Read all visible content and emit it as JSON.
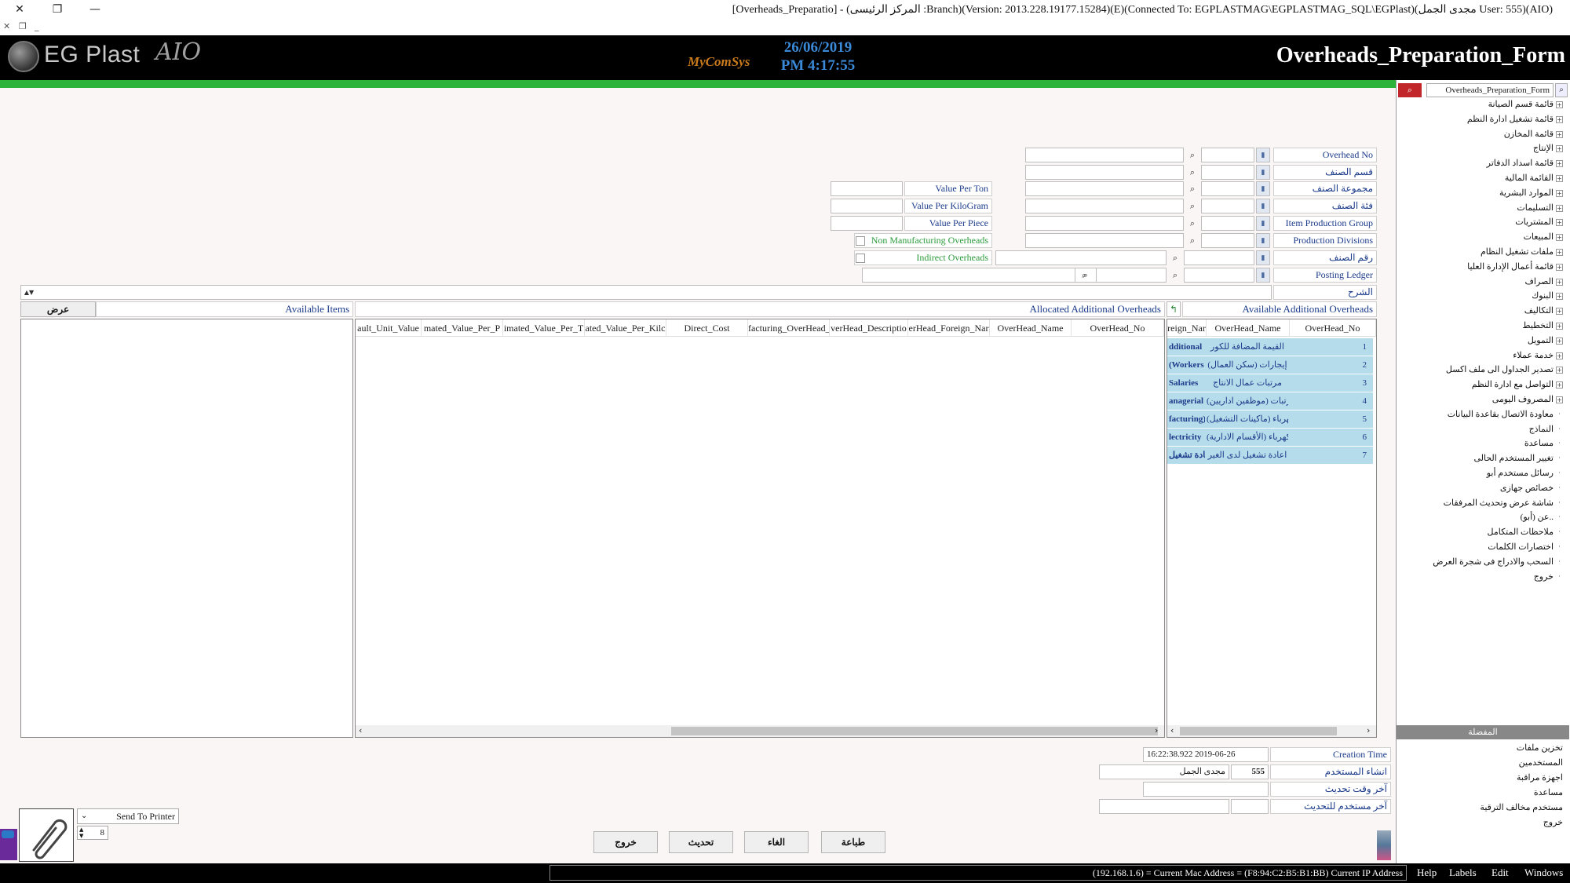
{
  "window": {
    "title": "[Overheads_Preparatio] - (المركز الرئيسى :Branch)(Version: 2013.228.19177.15284)(E)(Connected To: EGPLASTMAG\\EGPLASTMAG_SQL\\EGPlast)(مجدى الجمل User: 555)(AIO)"
  },
  "header": {
    "logo_text": "EG Plast",
    "logo_suffix": "AIO",
    "mycomsys": "MyComSys",
    "date": "26/06/2019",
    "time": "PM 4:17:55",
    "form_title": "Overheads_Preparation_Form"
  },
  "form": {
    "fields_right": [
      {
        "label": "Overhead No"
      },
      {
        "label": "قسم الصنف"
      },
      {
        "label": "مجموعة الصنف"
      },
      {
        "label": "فئة الصنف"
      },
      {
        "label": "Item Production Group"
      },
      {
        "label": "Production Divisions"
      },
      {
        "label": "رقم الصنف"
      },
      {
        "label": "Posting Ledger"
      }
    ],
    "explanation_label": "الشرح",
    "value_labels": [
      "Value Per Ton",
      "Value Per KiloGram",
      "Value Per Piece"
    ],
    "non_manufacturing_label": "Non Manufacturing Overheads",
    "indirect_label": "Indirect Overheads"
  },
  "available_items": {
    "title": "Available Items",
    "show_button": "عرض"
  },
  "allocated": {
    "title": "Allocated Additional Overheads",
    "columns": [
      "ault_Unit_Value",
      "mated_Value_Per_P",
      "imated_Value_Per_T",
      "ated_Value_Per_Kilc",
      "Direct_Cost",
      "facturing_OverHead_",
      "verHead_Descriptio",
      "erHead_Foreign_Nar",
      "OverHead_Name",
      "OverHead_No"
    ]
  },
  "available_overheads": {
    "title": "Available Additional Overheads",
    "columns": [
      "reign_Nar",
      "OverHead_Name",
      "OverHead_No"
    ],
    "rows": [
      {
        "no": "1",
        "name": "القيمة المضافة للكور",
        "foreign": "dditional"
      },
      {
        "no": "2",
        "name": "إيجارات (سكن العمال)",
        "foreign": "(Workers"
      },
      {
        "no": "3",
        "name": "مرتبات عمال الانتاج",
        "foreign": "Salaries"
      },
      {
        "no": "4",
        "name": "مرتبات (موظفين اداريين)",
        "foreign": "anagerial"
      },
      {
        "no": "5",
        "name": "كهرباء (ماكينات التشغيل)",
        "foreign": "facturing)"
      },
      {
        "no": "6",
        "name": "كهرباء (الأقسام الادارية)",
        "foreign": "lectricity"
      },
      {
        "no": "7",
        "name": "اعادة تشغيل لدى الغير",
        "foreign": "اعادة تشغيل"
      }
    ]
  },
  "footer": {
    "creation_time_label": "Creation Time",
    "creation_time_value": "16:22:38.922 2019-06-26",
    "creator_label": "انشاء المستخدم",
    "creator_id": "555",
    "creator_name": "مجدى الجمل",
    "last_update_label": "آخر وقت تحديث",
    "last_updater_label": "آخر مستخدم للتحديث",
    "printer_option": "Send To Printer",
    "copies": "8",
    "buttons": {
      "exit": "خروج",
      "update": "تحديث",
      "cancel": "الغاء",
      "print": "طباعة"
    }
  },
  "sidebar": {
    "search_value": "Overheads_Preparation_Form",
    "tree": [
      {
        "label": "قائمة قسم الصيانة",
        "expandable": true
      },
      {
        "label": "قائمة تشغيل ادارة النظم",
        "expandable": true
      },
      {
        "label": "قائمة المخازن",
        "expandable": true
      },
      {
        "label": "الإنتاج",
        "expandable": true
      },
      {
        "label": "قائمة اسداد الدفاتر",
        "expandable": true
      },
      {
        "label": "القائمة المالية",
        "expandable": true
      },
      {
        "label": "الموارد البشرية",
        "expandable": true
      },
      {
        "label": "التسليمات",
        "expandable": true
      },
      {
        "label": "المشتريات",
        "expandable": true
      },
      {
        "label": "المبيعات",
        "expandable": true
      },
      {
        "label": "ملفات تشغيل النظام",
        "expandable": true
      },
      {
        "label": "قائمة أعمال الإدارة العليا",
        "expandable": true
      },
      {
        "label": "الصراف",
        "expandable": true
      },
      {
        "label": "البنوك",
        "expandable": true
      },
      {
        "label": "التكاليف",
        "expandable": true
      },
      {
        "label": "التخطيط",
        "expandable": true
      },
      {
        "label": "التمويل",
        "expandable": true
      },
      {
        "label": "خدمة عملاء",
        "expandable": true
      },
      {
        "label": "تصدير الجداول الى ملف اكسل",
        "expandable": true
      },
      {
        "label": "التواصل مع ادارة النظم",
        "expandable": true
      },
      {
        "label": "المصروف اليومى",
        "expandable": true
      },
      {
        "label": "معاودة الاتصال بقاعدة البيانات",
        "expandable": false
      },
      {
        "label": "النماذج",
        "expandable": false
      },
      {
        "label": "مساعدة",
        "expandable": false
      },
      {
        "label": "تغيير المستخدم الحالى",
        "expandable": false
      },
      {
        "label": "رسائل مستخدم أبو",
        "expandable": false
      },
      {
        "label": "خصائص جهازى",
        "expandable": false
      },
      {
        "label": "شاشة عرض وتحديث المرفقات",
        "expandable": false
      },
      {
        "label": "عن (أبو)..",
        "expandable": false
      },
      {
        "label": "ملاحظات المتكامل",
        "expandable": false
      },
      {
        "label": "اختصارات الكلمات",
        "expandable": false
      },
      {
        "label": "السحب والادراج فى شجرة العرض",
        "expandable": false
      },
      {
        "label": "خروج",
        "expandable": false
      }
    ],
    "favorites_title": "المفضلة",
    "favorites": [
      "تخزين ملفات",
      "المستخدمين",
      "اجهزة مراقبة",
      "مساعدة",
      "مستخدم مخالف الترقية",
      "خروج"
    ]
  },
  "statusbar": {
    "text": "(192.168.1.6) = Current Mac Address = (F8:94:C2:B5:B1:BB) Current IP Address",
    "menu": [
      "Help",
      "Labels",
      "Edit",
      "Windows"
    ]
  }
}
